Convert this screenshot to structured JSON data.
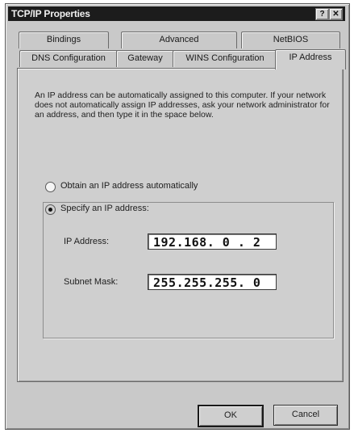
{
  "window": {
    "title": "TCP/IP Properties",
    "help_glyph": "?",
    "close_glyph": "✕"
  },
  "tabs_back": [
    {
      "label": "Bindings"
    },
    {
      "label": "Advanced"
    },
    {
      "label": "NetBIOS"
    }
  ],
  "tabs_front": [
    {
      "label": "DNS Configuration"
    },
    {
      "label": "Gateway"
    },
    {
      "label": "WINS Configuration"
    },
    {
      "label": "IP Address"
    }
  ],
  "active_tab": "IP Address",
  "description": "An IP address can be automatically assigned to this computer. If your network does not automatically assign IP addresses, ask your network administrator for an address, and then type it in the space below.",
  "options": {
    "obtain_label": "Obtain an IP address automatically",
    "specify_label": "Specify an IP address:",
    "selected": "specify"
  },
  "fields": {
    "ip_label": "IP Address:",
    "ip_value": "192.168. 0 . 2",
    "mask_label": "Subnet Mask:",
    "mask_value": "255.255.255. 0"
  },
  "buttons": {
    "ok_label": "OK",
    "cancel_label": "Cancel"
  },
  "colors": {
    "title_bar": "#1c1c1c",
    "face": "#c9c9c9",
    "field_bg": "#ffffff"
  },
  "icons": {
    "radio_selected": "radio-dot",
    "close": "close-x",
    "help": "question-mark"
  }
}
